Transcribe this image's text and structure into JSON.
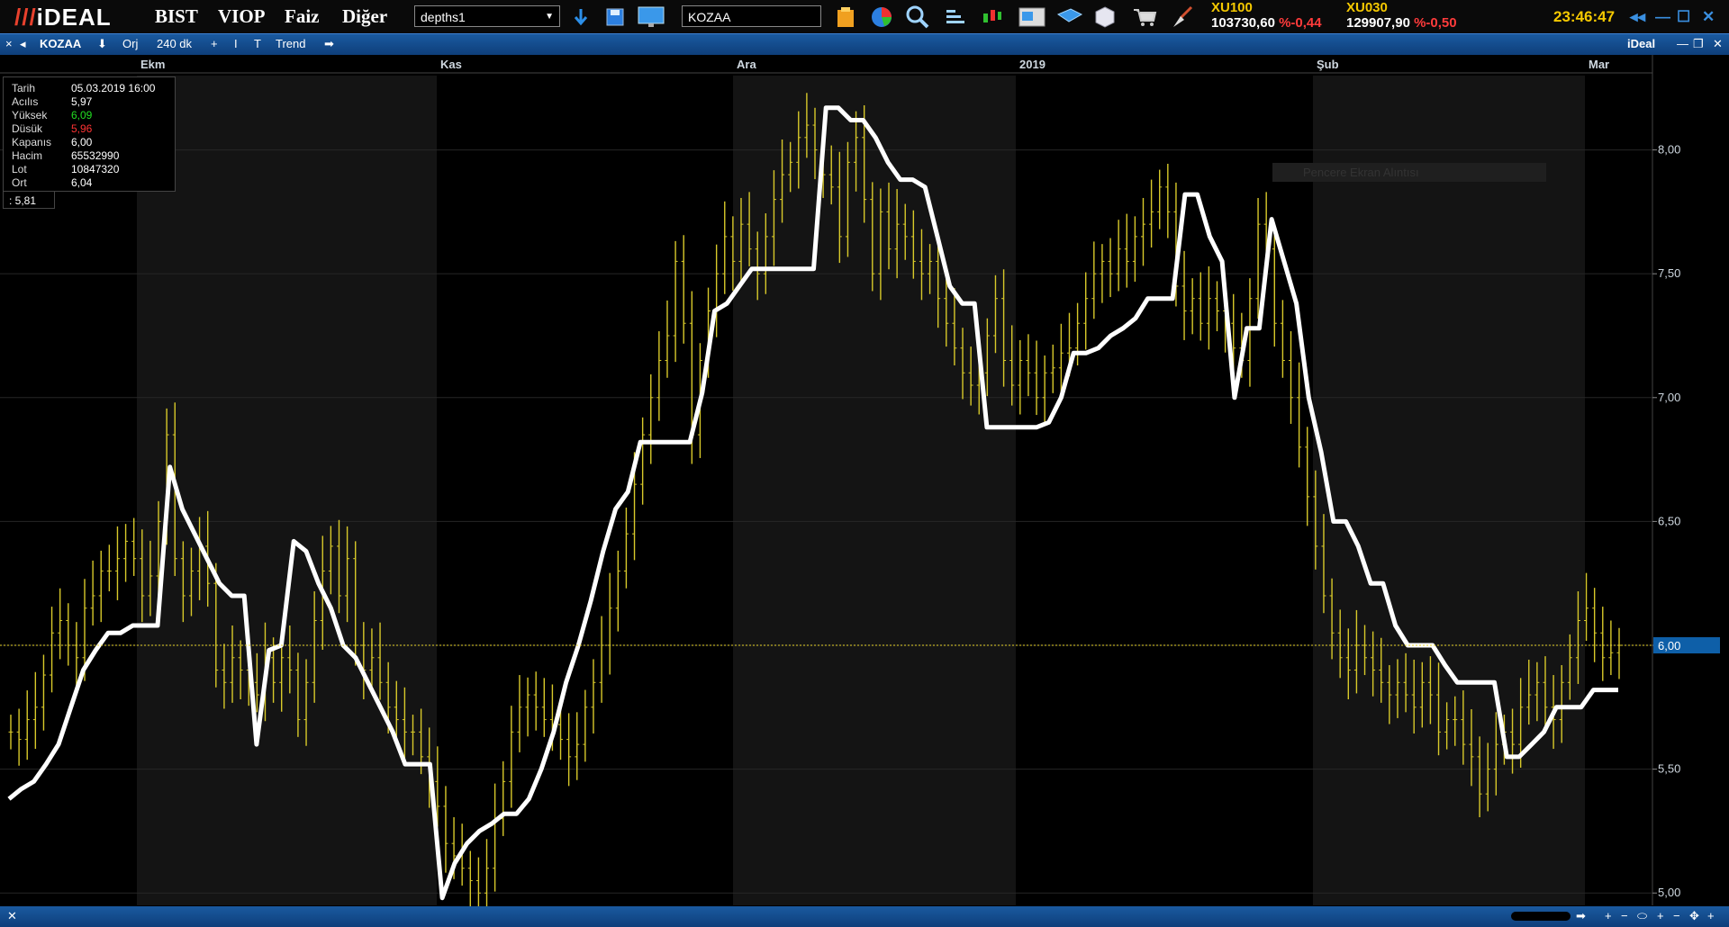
{
  "app": {
    "logo": "iDEAL",
    "menu": [
      "BIST",
      "VIOP",
      "Faiz",
      "Diğer"
    ],
    "layout_combo": "depths1",
    "symbol_input": "KOZAA",
    "clock": "23:46:47",
    "indices": [
      {
        "name": "XU100",
        "value": "103730,60",
        "change": "%-0,44"
      },
      {
        "name": "XU030",
        "value": "129907,90",
        "change": "%-0,50"
      }
    ]
  },
  "chart_toolbar": {
    "close": "×",
    "symbol": "KOZAA",
    "orj": "Orj",
    "period": "240 dk",
    "plus": "+",
    "bar": "I",
    "text_tool": "T",
    "trend": "Trend",
    "brand": "iDeal"
  },
  "info": {
    "rows": [
      {
        "k": "Tarih",
        "v": "05.03.2019 16:00"
      },
      {
        "k": "Acılıs",
        "v": "5,97"
      },
      {
        "k": "Yüksek",
        "v": "6,09"
      },
      {
        "k": "Düsük",
        "v": "5,96"
      },
      {
        "k": "Kapanıs",
        "v": "6,00"
      },
      {
        "k": "Hacim",
        "v": "65532990"
      },
      {
        "k": "Lot",
        "v": "10847320"
      },
      {
        "k": "Ort",
        "v": "6,04"
      }
    ],
    "current": ": 5,81"
  },
  "tooltip": "Pencere Ekran Alıntısı",
  "colors": {
    "price": "#d8c92a",
    "trail": "#ffffff",
    "up": "#22dd22",
    "down": "#ff3333",
    "accent": "#1a5aa0",
    "highlight": "#f5c900"
  },
  "chart_data": {
    "type": "line",
    "months": [
      "Ekm",
      "Kas",
      "Ara",
      "2019",
      "Şub",
      "Mar"
    ],
    "y_ticks": [
      "8,00",
      "7,50",
      "7,00",
      "6,50",
      "6,00",
      "5,50",
      "5,00"
    ],
    "ylim": [
      4.95,
      8.3
    ],
    "last_price": "6,00",
    "series": [
      {
        "values": [
          5.65,
          5.62,
          5.7,
          5.75,
          5.88,
          6.05,
          6.1,
          6.0,
          5.95,
          6.15,
          6.2,
          6.3,
          6.3,
          6.35,
          6.42,
          6.35,
          6.2,
          6.28,
          6.5,
          6.85,
          6.35,
          6.2,
          6.3,
          6.4,
          6.25,
          5.9,
          5.85,
          5.95,
          5.9,
          5.85,
          5.8,
          5.95,
          5.85,
          5.95,
          5.9,
          5.7,
          5.85,
          6.1,
          6.3,
          6.4,
          6.2,
          6.35,
          6.0,
          5.9,
          5.95,
          5.85,
          5.75,
          5.7,
          5.65,
          5.65,
          5.55,
          5.45,
          5.35,
          5.2,
          5.15,
          5.1,
          5.05,
          5.0,
          5.1,
          5.3,
          5.45,
          5.65,
          5.75,
          5.8,
          5.75,
          5.7,
          5.68,
          5.62,
          5.55,
          5.6,
          5.75,
          5.85,
          6.0,
          6.15,
          6.3,
          6.45,
          6.65,
          6.85,
          7.0,
          7.15,
          7.25,
          7.55,
          7.3,
          6.85,
          7.15,
          7.35,
          7.5,
          7.65,
          7.55,
          7.7,
          7.6,
          7.5,
          7.65,
          7.8,
          7.9,
          7.95,
          8.05,
          8.1,
          8.0,
          7.9,
          7.85,
          7.65,
          7.95,
          8.05,
          7.8,
          7.5,
          7.75,
          7.6,
          7.7,
          7.65,
          7.55,
          7.5,
          7.55,
          7.4,
          7.3,
          7.2,
          7.1,
          7.05,
          7.1,
          7.25,
          7.4,
          7.15,
          7.05,
          7.15,
          7.1,
          7.0,
          7.1,
          7.12,
          7.18,
          7.2,
          7.3,
          7.4,
          7.5,
          7.55,
          7.5,
          7.6,
          7.55,
          7.65,
          7.7,
          7.75,
          7.85,
          7.75,
          7.45,
          7.35,
          7.4,
          7.3,
          7.4,
          7.35,
          7.3,
          7.2,
          7.15,
          7.4,
          7.7,
          7.6,
          7.3,
          7.15,
          7.0,
          6.8,
          6.6,
          6.4,
          6.2,
          6.05,
          5.95,
          5.9,
          6.0,
          5.95,
          5.9,
          5.85,
          5.8,
          5.85,
          5.8,
          5.75,
          5.85,
          5.8,
          5.65,
          5.7,
          5.7,
          5.6,
          5.55,
          5.4,
          5.5,
          5.6,
          5.65,
          5.6,
          5.75,
          5.8,
          5.85,
          5.75,
          5.7,
          5.85,
          5.95,
          6.1,
          6.15,
          6.05,
          5.95,
          5.97,
          6.0
        ]
      },
      {
        "values": [
          5.38,
          5.42,
          5.45,
          5.52,
          5.6,
          5.75,
          5.9,
          5.98,
          6.05,
          6.05,
          6.08,
          6.08,
          6.08,
          6.72,
          6.55,
          6.45,
          6.35,
          6.25,
          6.2,
          6.2,
          5.6,
          5.98,
          6.0,
          6.42,
          6.38,
          6.25,
          6.15,
          6.0,
          5.95,
          5.85,
          5.75,
          5.65,
          5.52,
          5.52,
          5.52,
          4.98,
          5.12,
          5.2,
          5.25,
          5.28,
          5.32,
          5.32,
          5.38,
          5.5,
          5.65,
          5.85,
          6.0,
          6.18,
          6.38,
          6.55,
          6.62,
          6.82,
          6.82,
          6.82,
          6.82,
          6.82,
          7.02,
          7.35,
          7.38,
          7.45,
          7.52,
          7.52,
          7.52,
          7.52,
          7.52,
          7.52,
          8.17,
          8.17,
          8.12,
          8.12,
          8.05,
          7.95,
          7.88,
          7.88,
          7.85,
          7.65,
          7.45,
          7.38,
          7.38,
          6.88,
          6.88,
          6.88,
          6.88,
          6.88,
          6.9,
          7.0,
          7.18,
          7.18,
          7.2,
          7.25,
          7.28,
          7.32,
          7.4,
          7.4,
          7.4,
          7.82,
          7.82,
          7.65,
          7.55,
          7.0,
          7.28,
          7.28,
          7.72,
          7.55,
          7.38,
          7.0,
          6.78,
          6.5,
          6.5,
          6.4,
          6.25,
          6.25,
          6.08,
          6.0,
          6.0,
          6.0,
          5.92,
          5.85,
          5.85,
          5.85,
          5.85,
          5.55,
          5.55,
          5.6,
          5.65,
          5.75,
          5.75,
          5.75,
          5.82,
          5.82,
          5.82
        ]
      }
    ]
  }
}
